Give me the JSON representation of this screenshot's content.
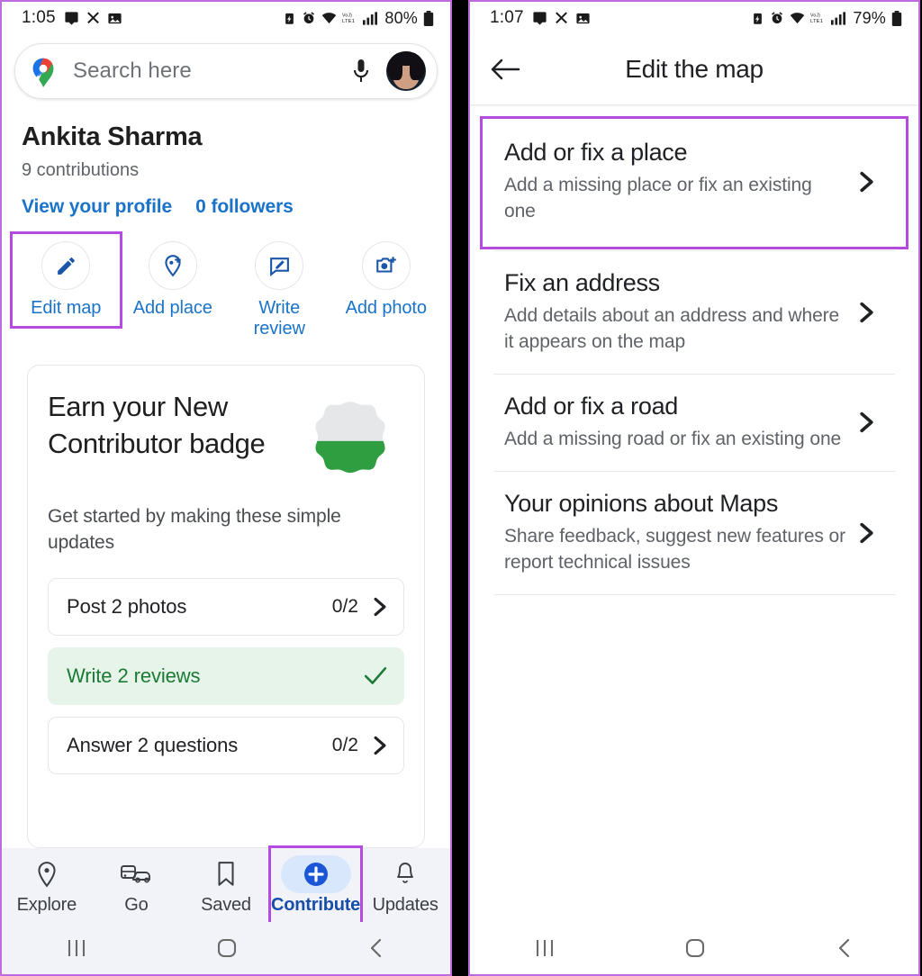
{
  "left_phone": {
    "status_bar": {
      "time": "1:05",
      "battery_percent": "80%",
      "left_icons": [
        "message-icon",
        "missed-call-icon",
        "photo-icon"
      ],
      "right_icons": [
        "battery-saver-icon",
        "alarm-icon",
        "wifi-icon",
        "volte-icon",
        "signal-icon",
        "battery-icon"
      ]
    },
    "search": {
      "placeholder": "Search here",
      "logo": "google-maps-logo",
      "mic": "microphone-icon",
      "avatar": "user-avatar"
    },
    "profile": {
      "name": "Ankita Sharma",
      "contributions": "9 contributions",
      "view_profile": "View your profile",
      "followers": "0 followers"
    },
    "actions": [
      {
        "label": "Edit map",
        "icon": "pencil-icon",
        "highlighted": true
      },
      {
        "label": "Add place",
        "icon": "add-place-pin-icon",
        "highlighted": false
      },
      {
        "label": "Write\nreview",
        "label_line1": "Write",
        "label_line2": "review",
        "icon": "write-review-icon",
        "highlighted": false
      },
      {
        "label": "Add photo",
        "icon": "add-photo-camera-icon",
        "highlighted": false
      }
    ],
    "badge_card": {
      "title": "Earn your New Contributor badge",
      "subtitle": "Get started by making these simple updates",
      "badge_icon": "contributor-badge-icon",
      "badge_colors": {
        "top": "#e6e7e9",
        "bottom": "#2f9e41"
      },
      "tasks": [
        {
          "label": "Post 2 photos",
          "count": "0/2",
          "done": false
        },
        {
          "label": "Write 2 reviews",
          "count": "",
          "done": true
        },
        {
          "label": "Answer 2 questions",
          "count": "0/2",
          "done": false
        }
      ]
    },
    "bottom_nav": [
      {
        "label": "Explore",
        "icon": "location-pin-icon",
        "active": false,
        "highlighted": false
      },
      {
        "label": "Go",
        "icon": "commute-icon",
        "active": false,
        "highlighted": false
      },
      {
        "label": "Saved",
        "icon": "bookmark-icon",
        "active": false,
        "highlighted": false
      },
      {
        "label": "Contribute",
        "icon": "plus-circle-icon",
        "active": true,
        "highlighted": true
      },
      {
        "label": "Updates",
        "icon": "bell-icon",
        "active": false,
        "highlighted": false
      }
    ],
    "system_nav": [
      "recents-icon",
      "home-icon",
      "back-icon"
    ]
  },
  "right_phone": {
    "status_bar": {
      "time": "1:07",
      "battery_percent": "79%",
      "left_icons": [
        "message-icon",
        "missed-call-icon",
        "photo-icon"
      ],
      "right_icons": [
        "battery-saver-icon",
        "alarm-icon",
        "wifi-icon",
        "volte-icon",
        "signal-icon",
        "battery-icon"
      ]
    },
    "header": {
      "back": "back-arrow-icon",
      "title": "Edit the map"
    },
    "items": [
      {
        "title": "Add or fix a place",
        "subtitle": "Add a missing place or fix an existing one",
        "chevron": "chevron-right-icon",
        "highlighted": true
      },
      {
        "title": "Fix an address",
        "subtitle": "Add details about an address and where it appears on the map",
        "chevron": "chevron-right-icon",
        "highlighted": false
      },
      {
        "title": "Add or fix a road",
        "subtitle": "Add a missing road or fix an existing one",
        "chevron": "chevron-right-icon",
        "highlighted": false
      },
      {
        "title": "Your opinions about Maps",
        "subtitle": "Share feedback, suggest new features or report technical issues",
        "chevron": "chevron-right-icon",
        "highlighted": false
      }
    ],
    "system_nav": [
      "recents-icon",
      "home-icon",
      "back-icon"
    ]
  },
  "colors": {
    "highlight_purple": "#b44ae0",
    "link_blue": "#1a73c8",
    "active_blue": "#184ea8",
    "pill_blue": "#d9e7fd",
    "done_green": "#1b7a34",
    "done_bg": "#e7f4e9"
  }
}
